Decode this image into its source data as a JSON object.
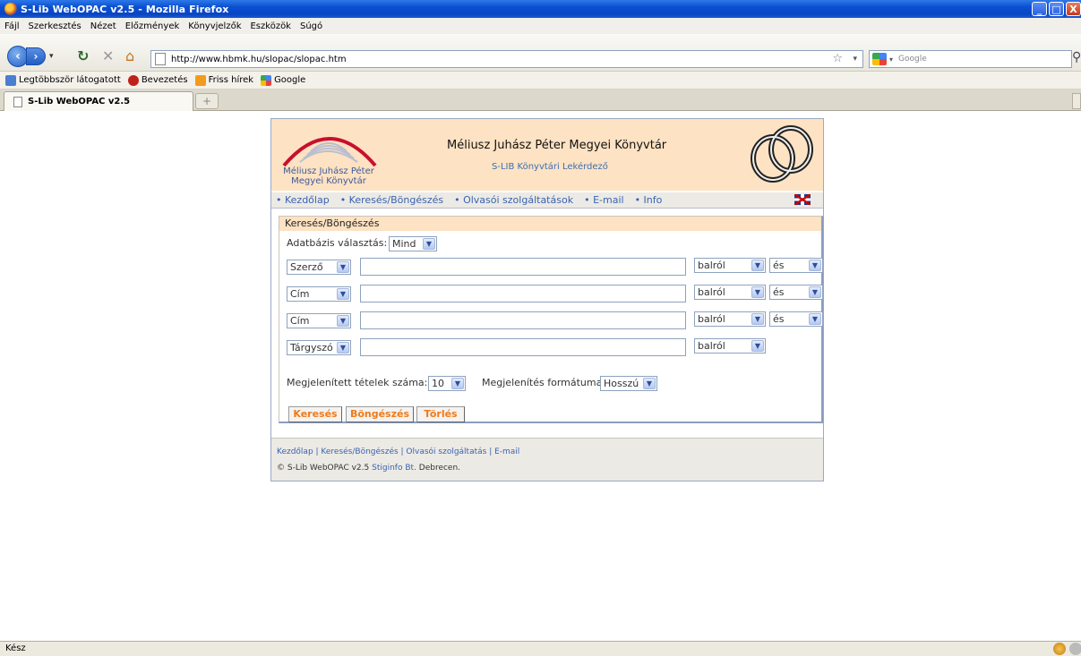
{
  "window": {
    "title": "S-Lib WebOPAC v2.5 - Mozilla Firefox",
    "buttons": [
      "_",
      "□",
      "X"
    ]
  },
  "menu": [
    "Fájl",
    "Szerkesztés",
    "Nézet",
    "Előzmények",
    "Könyvjelzők",
    "Eszközök",
    "Súgó"
  ],
  "nav": {
    "url": "http://www.hbmk.hu/slopac/slopac.htm",
    "search_placeholder": "Google"
  },
  "bookmarks": [
    "Legtöbbször látogatott",
    "Bevezetés",
    "Friss hírek",
    "Google"
  ],
  "tab": {
    "label": "S-Lib WebOPAC v2.5",
    "new_tab": "+"
  },
  "header": {
    "logo_line1": "Méliusz Juhász Péter",
    "logo_line2": "Megyei Könyvtár",
    "title": "Méliusz Juhász Péter Megyei Könyvtár",
    "subtitle": "S-LIB Könyvtári Lekérdező"
  },
  "topnav": [
    "• Kezdőlap",
    "• Keresés/Böngészés",
    "• Olvasói szolgáltatások",
    "• E-mail",
    "• Info"
  ],
  "search": {
    "panel_title": "Keresés/Böngészés",
    "db_label": "Adatbázis választás:",
    "db_value": "Mind",
    "rows": [
      {
        "field": "Szerző",
        "match": "balról",
        "op": "és"
      },
      {
        "field": "Cím",
        "match": "balról",
        "op": "és"
      },
      {
        "field": "Cím",
        "match": "balról",
        "op": "és"
      },
      {
        "field": "Tárgyszó",
        "match": "balról",
        "op": ""
      }
    ],
    "count_label": "Megjelenített tételek száma:",
    "count_value": "10",
    "format_label": "Megjelenítés formátuma:",
    "format_value": "Hosszú",
    "buttons": {
      "search": "Keresés",
      "browse": "Böngészés",
      "clear": "Törlés"
    }
  },
  "footer": {
    "links": "Kezdőlap | Keresés/Böngészés | Olvasói szolgáltatás | E-mail",
    "copy_prefix": "© S-Lib WebOPAC v2.5",
    "copy_link": "Stiginfo Bt.",
    "copy_suffix": "Debrecen."
  },
  "status": {
    "text": "Kész"
  },
  "colors": {
    "header_bg": "#fde2c3",
    "link": "#3a63b0",
    "button_text": "#f07a1a",
    "titlebar": "#0a4fd0"
  }
}
